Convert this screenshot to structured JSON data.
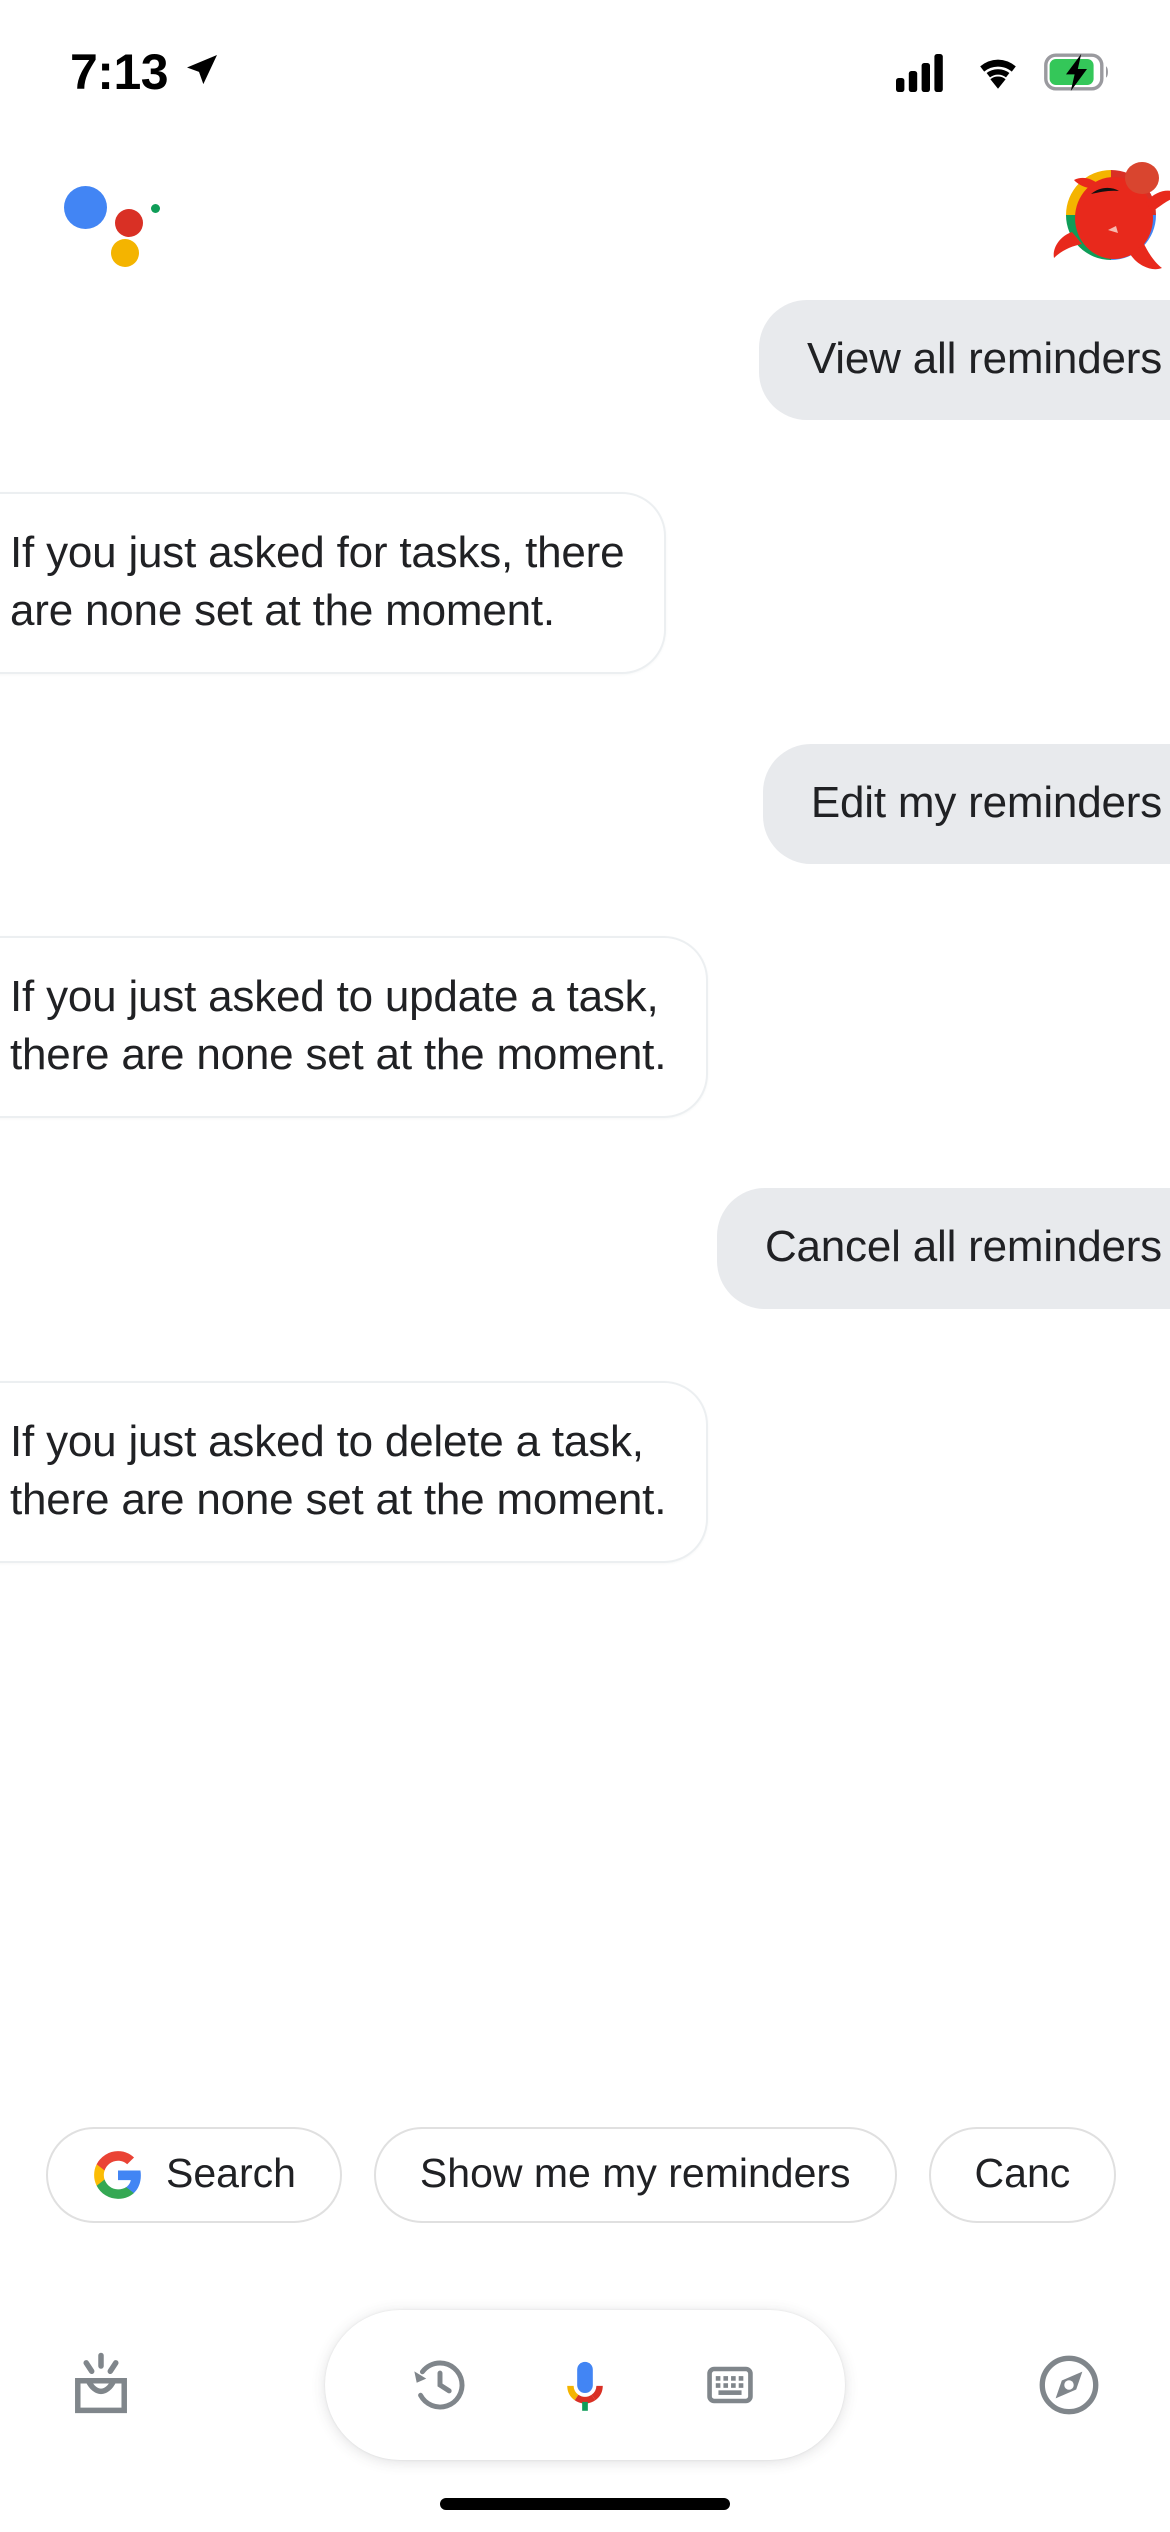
{
  "status_bar": {
    "time": "7:13",
    "location_icon": "location-arrow-icon",
    "signal_icon": "cellular-signal-icon",
    "wifi_icon": "wifi-icon",
    "battery_icon": "battery-charging-icon",
    "battery_color": "#34c759"
  },
  "header": {
    "assistant_logo": "google-assistant-logo",
    "avatar": "user-avatar-crab",
    "logo_colors": {
      "blue": "#4285f4",
      "red": "#d93025",
      "yellow": "#f4b400",
      "green": "#0f9d58"
    }
  },
  "conversation": {
    "messages": [
      {
        "role": "user",
        "text": "View all reminders"
      },
      {
        "role": "assistant",
        "text": "If you just asked for tasks, there\nare none set at the moment."
      },
      {
        "role": "user",
        "text": "Edit my reminders"
      },
      {
        "role": "assistant",
        "text": "If you just asked to update a task,\nthere are none set at the moment."
      },
      {
        "role": "user",
        "text": "Cancel all reminders"
      },
      {
        "role": "assistant",
        "text": "If you just asked to delete a task,\nthere are none set at the moment."
      }
    ],
    "user_bubble_color": "#e8eaed",
    "assistant_bubble_color": "#ffffff",
    "text_color": "#202124"
  },
  "suggestion_chips": [
    {
      "icon": "google-g-icon",
      "label": "Search"
    },
    {
      "icon": null,
      "label": "Show me my reminders"
    },
    {
      "icon": null,
      "label": "Canc"
    }
  ],
  "bottom_bar": {
    "snapshot": {
      "icon": "snapshot-inbox-icon",
      "label": "Snapshot"
    },
    "history": {
      "icon": "history-clock-icon",
      "label": "History"
    },
    "mic": {
      "icon": "google-mic-icon",
      "label": "Microphone"
    },
    "keyboard": {
      "icon": "keyboard-icon",
      "label": "Keyboard"
    },
    "explore": {
      "icon": "compass-explore-icon",
      "label": "Explore"
    },
    "icon_color": "#80868b"
  },
  "home_indicator": "home-indicator-bar"
}
